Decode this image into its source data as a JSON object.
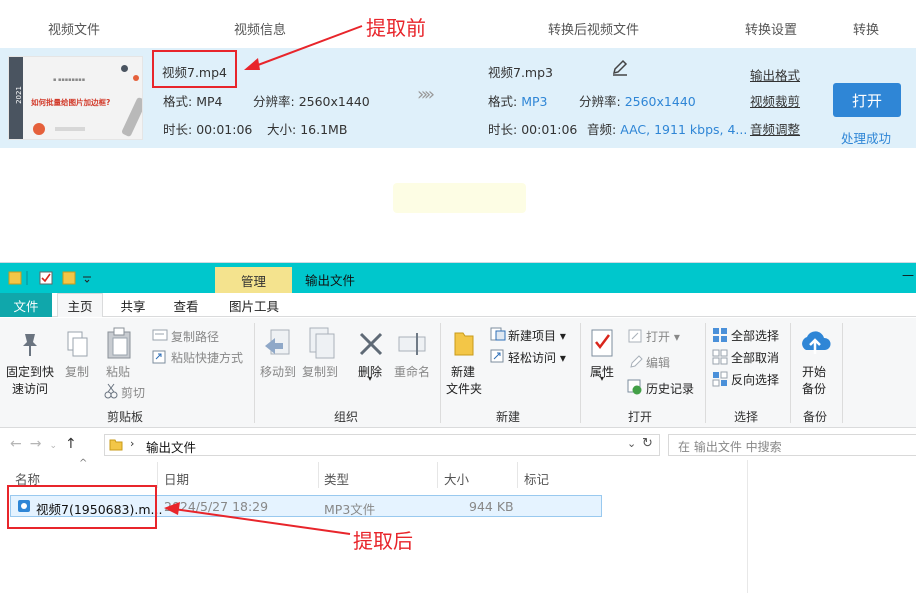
{
  "converter": {
    "headers": {
      "video_file": "视频文件",
      "video_info": "视频信息",
      "converted_file": "转换后视频文件",
      "settings": "转换设置",
      "convert": "转换"
    },
    "thumbnail": {
      "year": "2021",
      "title": "如何批量给图片加边框?"
    },
    "source": {
      "filename": "视频7.mp4",
      "format_label": "格式:",
      "format": "MP4",
      "resolution_label": "分辨率:",
      "resolution": "2560x1440",
      "duration_label": "时长:",
      "duration": "00:01:06",
      "size_label": "大小:",
      "size": "16.1MB"
    },
    "arrow": "»»",
    "output": {
      "filename": "视频7.mp3",
      "format_label": "格式:",
      "format": "MP3",
      "resolution_label": "分辨率:",
      "resolution": "2560x1440",
      "duration_label": "时长:",
      "duration": "00:01:06",
      "audio_label": "音频:",
      "audio": "AAC, 1911 kbps, 4..."
    },
    "settings_links": {
      "output_format": "输出格式",
      "video_crop": "视频裁剪",
      "audio_adjust": "音频调整"
    },
    "open_button": "打开",
    "status": "处理成功",
    "annotation_before": "提取前"
  },
  "explorer": {
    "title_tab_manage": "管理",
    "window_title": "输出文件",
    "min_button": "—",
    "tabs": {
      "file": "文件",
      "home": "主页",
      "share": "共享",
      "view": "查看",
      "picture_tools": "图片工具"
    },
    "ribbon": {
      "pin": "固定到快\n速访问",
      "pin_l1": "固定到快",
      "pin_l2": "速访问",
      "copy": "复制",
      "paste": "粘贴",
      "copy_path": "复制路径",
      "paste_shortcut": "粘贴快捷方式",
      "cut": "剪切",
      "clipboard_group": "剪贴板",
      "move_to": "移动到",
      "copy_to": "复制到",
      "delete": "删除",
      "rename": "重命名",
      "organize_group": "组织",
      "new_folder_l1": "新建",
      "new_folder_l2": "文件夹",
      "new_item": "新建项目",
      "easy_access": "轻松访问",
      "new_group": "新建",
      "properties": "属性",
      "open": "打开",
      "edit": "编辑",
      "history": "历史记录",
      "open_group": "打开",
      "select_all": "全部选择",
      "select_none": "全部取消",
      "invert": "反向选择",
      "select_group": "选择",
      "backup_l1": "开始",
      "backup_l2": "备份",
      "backup_group": "备份"
    },
    "address": {
      "path": "输出文件",
      "search_placeholder": "在 输出文件 中搜索"
    },
    "columns": {
      "name": "名称",
      "date": "日期",
      "type": "类型",
      "size": "大小",
      "tags": "标记"
    },
    "file": {
      "name": "视频7(1950683).m...",
      "date": "2024/5/27 18:29",
      "type": "MP3文件",
      "size": "944 KB"
    },
    "annotation_after": "提取后"
  },
  "colors": {
    "accent_blue": "#2f86d6",
    "annotation_red": "#e8252b",
    "titlebar_teal": "#00c7cc",
    "row_bg": "#dff0fa"
  }
}
